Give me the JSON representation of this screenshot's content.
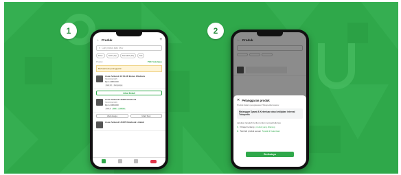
{
  "colors": {
    "brand_green": "#2fa84a",
    "danger_red": "#e0364a"
  },
  "steps": [
    "1",
    "2"
  ],
  "phone1": {
    "title": "Produk",
    "search_placeholder": "Cari produk atau SKU",
    "filters": [
      "Filter",
      "Aktif (12)",
      "Nonaktif (10)",
      "Sta"
    ],
    "count_label": "Produk",
    "count_action": "Pilih Sekaligus",
    "alert": "Berhasil ada pelanggaran",
    "product1": {
      "name": "Asus Zenbook 13 OLED Bonus Windows",
      "sku": "SKU0012345",
      "price": "Rp 14.999.000",
      "tags": [
        "Stok 10",
        "Kampanye"
      ]
    },
    "view_detail": "Lihat Detail",
    "product2": {
      "name": "Asus Zenbook UX325 Notebook",
      "sku": "SKU0012346",
      "price": "Rp 12.499.000",
      "tags": [
        "Stok 4",
        "Aktif",
        "1 Varian"
      ]
    },
    "btn_change_price": "Ubah Harga",
    "btn_change_stock": "Ubah Stok",
    "product3": {
      "name": "Asus Zenbook UX425 Notebook Limited"
    },
    "nav": [
      "Beranda",
      "Produk",
      "Chat",
      "Feed"
    ]
  },
  "phone2": {
    "title": "Produk",
    "sheet_title": "Pelanggaran produk",
    "sheet_sub": "Produk dalam pengawasan Tokopedia karena:",
    "sheet_reason": "Melanggar Syarat & Ketentuan atau kebijakan internal Tokopedia",
    "sheet_note": "Lakukan langkah berikut untuk memperbaikinya:",
    "steps": [
      {
        "num": "1.",
        "text": "Pelajari tentang",
        "link": "produk yang dilarang"
      },
      {
        "num": "2.",
        "text": "Tambah produk sesuai",
        "link": "Syarat & Ketentuan"
      }
    ],
    "sheet_button": "Berikutnya"
  }
}
